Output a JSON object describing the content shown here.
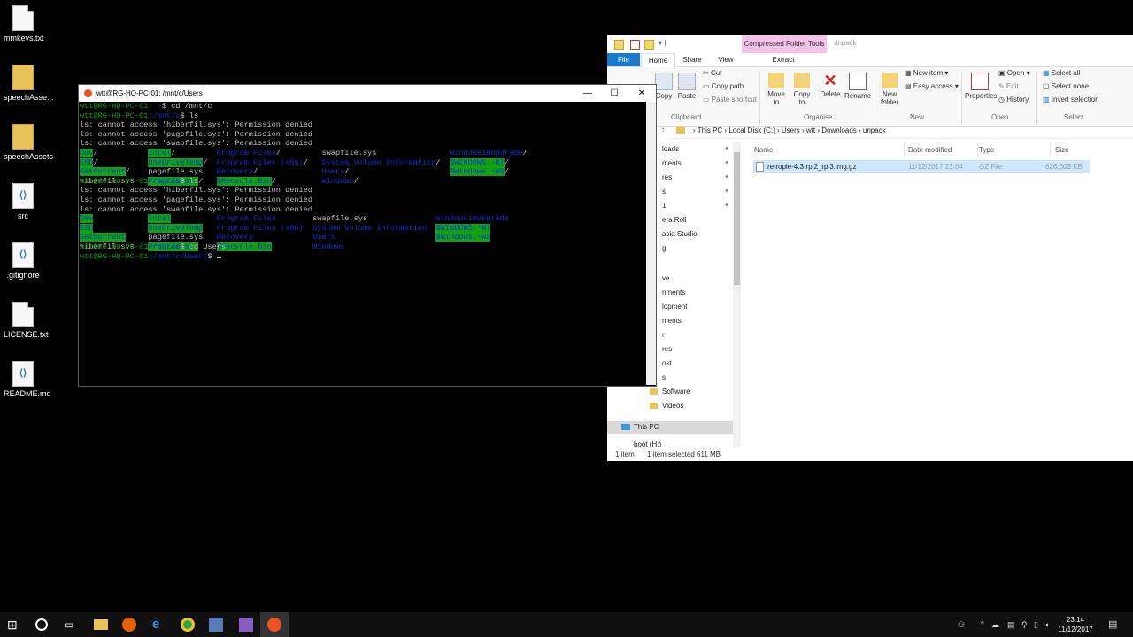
{
  "desktop": {
    "icons": [
      {
        "label": "mmkeys.txt",
        "kind": "doc"
      },
      {
        "label": "speechAsse...",
        "kind": "folder"
      },
      {
        "label": "speechAssets",
        "kind": "folder"
      },
      {
        "label": "src",
        "kind": "vsc"
      },
      {
        "label": ".gitignore",
        "kind": "vsc"
      },
      {
        "label": "LICENSE.txt",
        "kind": "doc"
      },
      {
        "label": "README.md",
        "kind": "vsc"
      }
    ]
  },
  "explorer": {
    "context_tab": "Compressed Folder Tools",
    "context_subtitle": "unpack",
    "tabs": {
      "file": "File",
      "home": "Home",
      "share": "Share",
      "view": "View",
      "extract": "Extract"
    },
    "ribbon": {
      "copy": "Copy",
      "paste": "Paste",
      "cut": "Cut",
      "copy_path": "Copy path",
      "paste_shortcut": "Paste shortcut",
      "clipboard": "Clipboard",
      "move_to": "Move to",
      "copy_to": "Copy to",
      "delete": "Delete",
      "rename": "Rename",
      "organise": "Organise",
      "new_folder": "New folder",
      "new_item": "New item",
      "easy_access": "Easy access",
      "new": "New",
      "properties": "Properties",
      "open": "Open",
      "edit": "Edit",
      "history": "History",
      "open_group": "Open",
      "select_all": "Select all",
      "select_none": "Select none",
      "invert_selection": "Invert selection",
      "select": "Select"
    },
    "address": [
      "This PC",
      "Local Disk (C:)",
      "Users",
      "wtt",
      "Downloads",
      "unpack"
    ],
    "nav_items": [
      {
        "label": "loads",
        "pinned": true
      },
      {
        "label": "ments",
        "pinned": true
      },
      {
        "label": "res",
        "pinned": true
      },
      {
        "label": "s",
        "pinned": true
      },
      {
        "label": "1",
        "pinned": true
      },
      {
        "label": "era Roll",
        "pinned": false
      },
      {
        "label": "asia Studio",
        "pinned": false
      },
      {
        "label": "g",
        "pinned": false
      },
      {
        "label": "",
        "pinned": false
      },
      {
        "label": "ve",
        "pinned": false
      },
      {
        "label": "nments",
        "pinned": false
      },
      {
        "label": "lopment",
        "pinned": false
      },
      {
        "label": "ments",
        "pinned": false
      },
      {
        "label": "r",
        "pinned": false
      },
      {
        "label": "res",
        "pinned": false
      },
      {
        "label": "ost",
        "pinned": false
      },
      {
        "label": "s",
        "pinned": false
      },
      {
        "label": "Software",
        "pinned": false
      },
      {
        "label": "Videos",
        "pinned": false
      }
    ],
    "this_pc": "This PC",
    "boot": "boot (H:)",
    "columns": {
      "name": "Name",
      "date": "Date modified",
      "type": "Type",
      "size": "Size"
    },
    "files": [
      {
        "name": "retropie-4.3-rpi2_rpi3.img.gz",
        "date": "11/12/2017 23:04",
        "type": "GZ File",
        "size": "626,603 KB"
      }
    ],
    "status": {
      "items": "1 item",
      "selected": "1 item selected  611 MB"
    }
  },
  "terminal": {
    "title": "wtt@RG-HQ-PC-01: /mnt/c/Users",
    "lines": [
      [
        {
          "t": "wtt@RG-HQ-PC-01:",
          "c": "pu"
        },
        {
          "t": " ~",
          "c": "pb"
        },
        {
          "t": "$ cd /mnt/c",
          "c": ""
        }
      ],
      [
        {
          "t": "wtt@RG-HQ-PC-01:",
          "c": "pu"
        },
        {
          "t": "/mnt/c",
          "c": "pb"
        },
        {
          "t": "$ ls",
          "c": ""
        }
      ],
      [
        {
          "t": "ls: cannot access 'hiberfil.sys': Permission denied",
          "c": ""
        }
      ],
      [
        {
          "t": "ls: cannot access 'pagefile.sys': Permission denied",
          "c": ""
        }
      ],
      [
        {
          "t": "ls: cannot access 'swapfile.sys': Permission denied",
          "c": ""
        }
      ]
    ],
    "ls1": [
      [
        {
          "t": "Dev",
          "c": "grn"
        },
        {
          "t": "/",
          "c": ""
        }
      ],
      [
        {
          "t": "Intel",
          "c": "grn"
        },
        {
          "t": "/",
          "c": ""
        }
      ],
      [
        {
          "t": "Program Files",
          "c": "pb"
        },
        {
          "t": "/",
          "c": ""
        }
      ],
      [
        {
          "t": "swapfile.sys",
          "c": ""
        }
      ],
      [
        {
          "t": "Windows10Upgrade",
          "c": "pb"
        },
        {
          "t": "/",
          "c": ""
        }
      ],
      [
        {
          "t": "ESD",
          "c": "grn"
        },
        {
          "t": "/",
          "c": ""
        }
      ],
      [
        {
          "t": "OneDriveTemp",
          "c": "grn"
        },
        {
          "t": "/",
          "c": ""
        }
      ],
      [
        {
          "t": "Program Files (x86)",
          "c": "pb"
        },
        {
          "t": "/",
          "c": ""
        }
      ],
      [
        {
          "t": "System Volume Information",
          "c": "pb"
        },
        {
          "t": "/",
          "c": ""
        }
      ],
      [
        {
          "t": "$WINDOWS.~BT",
          "c": "grn"
        },
        {
          "t": "/",
          "c": ""
        }
      ],
      [
        {
          "t": "GetCurrent",
          "c": "grn"
        },
        {
          "t": "/",
          "c": ""
        }
      ],
      [
        {
          "t": "pagefile.sys",
          "c": ""
        }
      ],
      [
        {
          "t": "Recovery",
          "c": "pb"
        },
        {
          "t": "/",
          "c": ""
        }
      ],
      [
        {
          "t": "Users",
          "c": "pb"
        },
        {
          "t": "/",
          "c": ""
        }
      ],
      [
        {
          "t": "$Windows.~WS",
          "c": "grn"
        },
        {
          "t": "/",
          "c": ""
        }
      ],
      [
        {
          "t": "hiberfil.sys",
          "c": ""
        }
      ],
      [
        {
          "t": "ProgramData",
          "c": "grn"
        },
        {
          "t": "/",
          "c": ""
        }
      ],
      [
        {
          "t": "$Recycle.Bin",
          "c": "grn"
        },
        {
          "t": "/",
          "c": ""
        }
      ],
      [
        {
          "t": "Windows",
          "c": "pb"
        },
        {
          "t": "/",
          "c": ""
        }
      ]
    ],
    "cmd2": [
      {
        "t": "wtt@RG-HQ-PC-01:",
        "c": "pu"
      },
      {
        "t": "/mnt/c",
        "c": "pb"
      },
      {
        "t": "$ ls",
        "c": ""
      }
    ],
    "errs2": [
      "ls: cannot access 'hiberfil.sys': Permission denied",
      "ls: cannot access 'pagefile.sys': Permission denied",
      "ls: cannot access 'swapfile.sys': Permission denied"
    ],
    "ls2": [
      [
        {
          "t": "Dev",
          "c": "grn"
        }
      ],
      [
        {
          "t": "Intel",
          "c": "grn"
        }
      ],
      [
        {
          "t": "Program Files",
          "c": "pb"
        }
      ],
      [
        {
          "t": "swapfile.sys",
          "c": ""
        }
      ],
      [
        {
          "t": "Windows10Upgrade",
          "c": "pb"
        }
      ],
      [
        {
          "t": "ESD",
          "c": "grn"
        }
      ],
      [
        {
          "t": "OneDriveTemp",
          "c": "grn"
        }
      ],
      [
        {
          "t": "Program Files (x86)",
          "c": "pb"
        }
      ],
      [
        {
          "t": "System Volume Information",
          "c": "pb"
        }
      ],
      [
        {
          "t": "$WINDOWS.~BT",
          "c": "grn"
        }
      ],
      [
        {
          "t": "GetCurrent",
          "c": "grn"
        }
      ],
      [
        {
          "t": "pagefile.sys",
          "c": ""
        }
      ],
      [
        {
          "t": "Recovery",
          "c": "pb"
        }
      ],
      [
        {
          "t": "Users",
          "c": "pb"
        }
      ],
      [
        {
          "t": "$Windows.~WS",
          "c": "grn"
        }
      ],
      [
        {
          "t": "hiberfil.sys",
          "c": ""
        }
      ],
      [
        {
          "t": "ProgramData",
          "c": "grn"
        }
      ],
      [
        {
          "t": "$Recycle.Bin",
          "c": "grn"
        }
      ],
      [
        {
          "t": "Windows",
          "c": "pb"
        }
      ]
    ],
    "cmd3": [
      {
        "t": "wtt@RG-HQ-PC-01:",
        "c": "pu"
      },
      {
        "t": "/mnt/c",
        "c": "pb"
      },
      {
        "t": "$ cd Users",
        "c": ""
      }
    ],
    "cmd4": [
      {
        "t": "wtt@RG-HQ-PC-01:",
        "c": "pu"
      },
      {
        "t": "/mnt/c/Users",
        "c": "pb"
      },
      {
        "t": "$ ",
        "c": ""
      }
    ]
  },
  "taskbar": {
    "clock_time": "23:14",
    "clock_date": "11/12/2017",
    "icons": [
      "start-icon",
      "cortana-icon",
      "task-view-icon",
      "file-explorer-icon",
      "firefox-icon",
      "edge-icon",
      "chrome-icon",
      "app-icon",
      "visual-studio-icon",
      "ubuntu-icon"
    ]
  },
  "colors": {
    "accent": "#1979ca",
    "context": "#f7c2e9",
    "ubuntu": "#e95420",
    "term_green": "#13a10e",
    "term_blue": "#0037da"
  }
}
